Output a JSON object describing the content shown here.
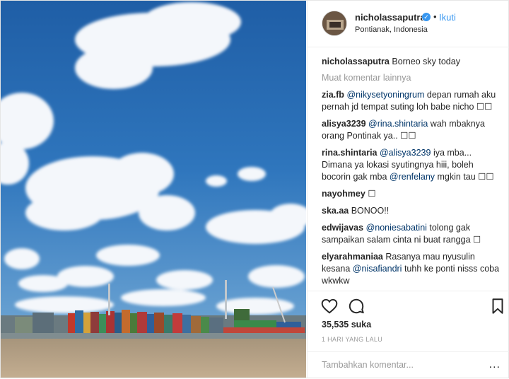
{
  "post": {
    "username": "nicholassaputra",
    "follow_label": "Ikuti",
    "separator": "•",
    "location": "Pontianak, Indonesia",
    "caption_user": "nicholassaputra",
    "caption_text": "Borneo sky today",
    "load_more": "Muat komentar lainnya"
  },
  "comments": [
    {
      "user": "zia.fb",
      "mention": "@nikysetyoningrum",
      "text": "depan rumah aku pernah jd tempat suting loh babe nicho ☐☐"
    },
    {
      "user": "alisya3239",
      "mention": "@rina.shintaria",
      "text": "wah mbaknya orang Pontinak ya.. ☐☐"
    },
    {
      "user": "rina.shintaria",
      "mention": "@alisya3239",
      "text": "iya mba... Dimana ya lokasi syutingnya hiii, boleh bocorin gak mba",
      "mention2": "@renfelany",
      "text2": "mgkin tau ☐☐"
    },
    {
      "user": "nayohmey",
      "text": "☐"
    },
    {
      "user": "ska.aa",
      "text": "BONOO!!"
    },
    {
      "user": "edwijavas",
      "mention": "@noniesabatini",
      "text": "tolong gak sampaikan salam cinta ni buat rangga ☐"
    },
    {
      "user": "elyarahmaniaa",
      "text": "Rasanya mau nyusulin kesana",
      "mention": "@nisafiandri",
      "text2": "tuhh ke ponti nisss coba wkwkw"
    }
  ],
  "footer": {
    "likes": "35,535 suka",
    "time": "1 HARI YANG LALU",
    "comment_placeholder": "Tambahkan komentar...",
    "more_options": "..."
  },
  "icons": [
    "heart-icon",
    "comment-icon",
    "bookmark-icon",
    "verified-badge-icon"
  ],
  "colors": {
    "link": "#3897f0",
    "mention": "#003569",
    "muted": "#999999",
    "sky": "#2d6fb5"
  }
}
